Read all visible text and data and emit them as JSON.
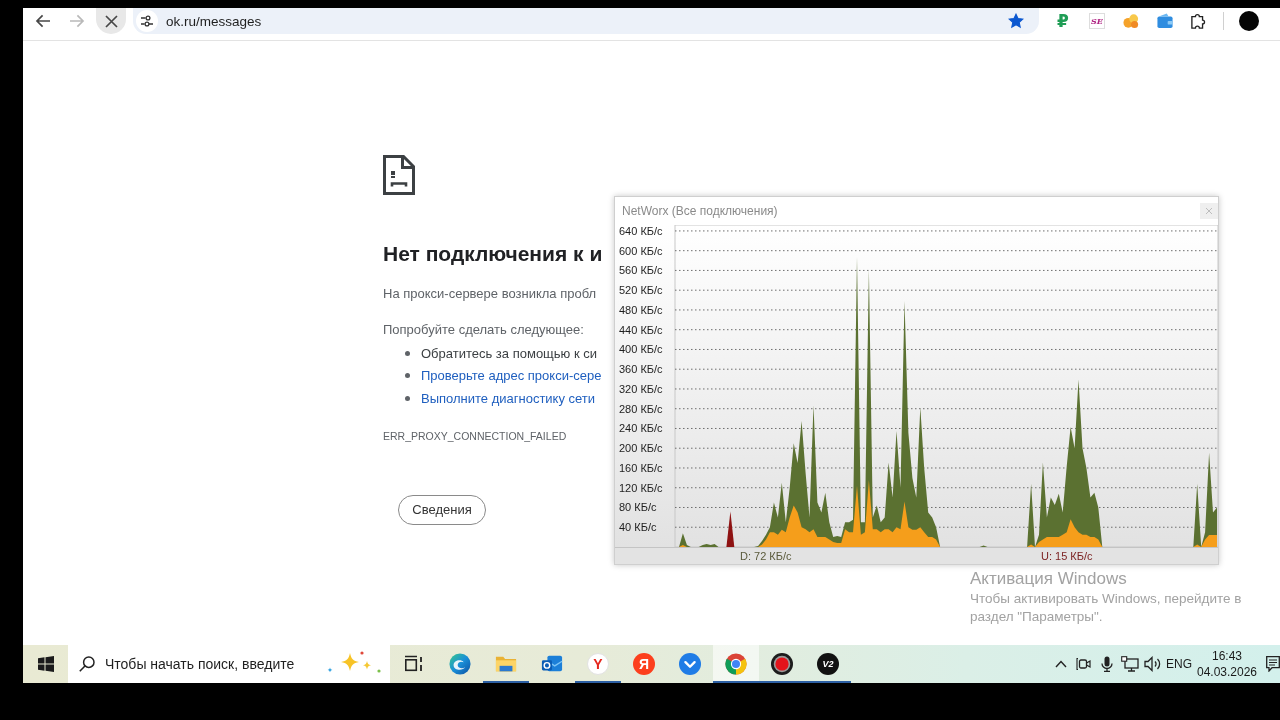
{
  "browser": {
    "back": {
      "disabled": false
    },
    "forward": {
      "disabled": true
    },
    "reload": {
      "loading": true,
      "hovered": true
    },
    "url": "ok.ru/messages",
    "bookmarked": true,
    "extensions": [
      {
        "kind": "ruble",
        "glyph": "₽"
      },
      {
        "kind": "letters",
        "glyph": "SE"
      },
      {
        "kind": "blobs"
      },
      {
        "kind": "wallet"
      },
      {
        "kind": "puzzle"
      }
    ]
  },
  "error_page": {
    "heading": "Нет подключения к и",
    "message": "На прокси-сервере возникла пробл",
    "suggestions_title": "Попробуйте сделать следующее:",
    "suggestions": [
      {
        "text": "Обратитесь за помощью к си",
        "link": false
      },
      {
        "text": "Проверьте адрес прокси-сере",
        "link": true
      },
      {
        "text": "Выполните диагностику сети",
        "link": true
      }
    ],
    "error_code": "ERR_PROXY_CONNECTION_FAILED",
    "details_button": "Сведения"
  },
  "networx": {
    "title": "NetWorx (Все подключения)",
    "chart_data": {
      "type": "area",
      "series": [
        {
          "color": "#5b7131",
          "values": [
            0,
            0,
            28,
            4,
            0,
            0,
            0,
            4,
            6,
            4,
            6,
            0,
            0,
            0,
            0,
            0,
            0,
            0,
            0,
            0,
            0,
            2,
            12,
            25,
            40,
            90,
            60,
            130,
            50,
            120,
            210,
            170,
            255,
            150,
            60,
            287,
            90,
            70,
            110,
            50,
            20,
            22,
            20,
            50,
            50,
            55,
            587,
            50,
            50,
            562,
            60,
            84,
            50,
            60,
            171,
            100,
            235,
            120,
            498,
            231,
            140,
            100,
            283,
            160,
            70,
            60,
            40,
            0,
            0,
            0,
            0,
            0,
            0,
            0,
            0,
            0,
            0,
            0,
            3,
            0,
            0,
            0,
            0,
            0,
            0,
            0,
            0,
            0,
            0,
            0,
            128,
            0,
            25,
            171,
            60,
            100,
            85,
            108,
            70,
            163,
            243,
            200,
            339,
            200,
            160,
            100,
            110,
            80,
            0,
            0,
            0,
            0,
            0,
            0,
            0,
            0,
            0,
            0,
            0,
            0,
            0,
            0,
            0,
            0,
            0,
            0,
            0,
            0,
            0,
            0,
            0,
            0,
            128,
            0,
            30,
            191,
            70,
            80
          ]
        },
        {
          "color": "#f59e1b",
          "values": [
            0,
            0,
            4,
            0,
            0,
            0,
            0,
            0,
            0,
            0,
            0,
            0,
            0,
            0,
            0,
            0,
            0,
            0,
            0,
            0,
            0,
            0,
            5,
            15,
            30,
            30,
            25,
            35,
            30,
            60,
            84,
            70,
            40,
            36,
            30,
            36,
            20,
            20,
            20,
            15,
            10,
            8,
            8,
            36,
            30,
            30,
            124,
            25,
            30,
            135,
            36,
            36,
            30,
            36,
            36,
            30,
            40,
            36,
            92,
            40,
            35,
            35,
            40,
            30,
            20,
            20,
            15,
            0,
            0,
            0,
            0,
            0,
            0,
            0,
            0,
            0,
            0,
            0,
            0,
            0,
            0,
            0,
            0,
            0,
            0,
            0,
            0,
            0,
            0,
            0,
            5,
            0,
            10,
            15,
            20,
            20,
            20,
            20,
            25,
            30,
            56,
            40,
            30,
            25,
            25,
            20,
            20,
            15,
            0,
            0,
            0,
            0,
            0,
            0,
            0,
            0,
            0,
            0,
            0,
            0,
            0,
            0,
            0,
            0,
            0,
            0,
            0,
            0,
            0,
            0,
            0,
            0,
            5,
            0,
            15,
            24,
            24,
            24
          ]
        },
        {
          "color": "#8e1212",
          "values": [
            null,
            null,
            null,
            null,
            null,
            null,
            null,
            null,
            null,
            null,
            null,
            null,
            null,
            0,
            72,
            0,
            null,
            null,
            null,
            null,
            null,
            null,
            null,
            null,
            null,
            null,
            null,
            null,
            null,
            null,
            null,
            null,
            null,
            null,
            null,
            null,
            null,
            null,
            null,
            null,
            null,
            null,
            null,
            null,
            null,
            null,
            null,
            null,
            null,
            null,
            null,
            null,
            null,
            null,
            null,
            null,
            null,
            null,
            null,
            null,
            null,
            null,
            null,
            null,
            null,
            null,
            null,
            null,
            null,
            null,
            null,
            null,
            null,
            null,
            null,
            null,
            null,
            null,
            null,
            null,
            null,
            null,
            null,
            null,
            null,
            null,
            null,
            null,
            null,
            null,
            null,
            null,
            null,
            null,
            null,
            null,
            null,
            null,
            null,
            null,
            null,
            null,
            null,
            null,
            null,
            null,
            null,
            null,
            null,
            null,
            null,
            null,
            null,
            null,
            null,
            null,
            null,
            null,
            null,
            null,
            null,
            null,
            null,
            null,
            null,
            null,
            null,
            null,
            null,
            null,
            null,
            null,
            null,
            null,
            null,
            null
          ]
        }
      ],
      "ylim": [
        0,
        652
      ],
      "yticks": [
        {
          "value": 40,
          "label": "40 КБ/с"
        },
        {
          "value": 80,
          "label": "80 КБ/с"
        },
        {
          "value": 120,
          "label": "120 КБ/с"
        },
        {
          "value": 160,
          "label": "160 КБ/с"
        },
        {
          "value": 200,
          "label": "200 КБ/с"
        },
        {
          "value": 240,
          "label": "240 КБ/с"
        },
        {
          "value": 280,
          "label": "280 КБ/с"
        },
        {
          "value": 320,
          "label": "320 КБ/с"
        },
        {
          "value": 360,
          "label": "360 КБ/с"
        },
        {
          "value": 400,
          "label": "400 КБ/с"
        },
        {
          "value": 440,
          "label": "440 КБ/с"
        },
        {
          "value": 480,
          "label": "480 КБ/с"
        },
        {
          "value": 520,
          "label": "520 КБ/с"
        },
        {
          "value": 560,
          "label": "560 КБ/с"
        },
        {
          "value": 600,
          "label": "600 КБ/с"
        },
        {
          "value": 640,
          "label": "640 КБ/с"
        }
      ],
      "tick_labels": "y",
      "grid": true
    },
    "status": {
      "download": "D: 72 КБ/с",
      "upload": "U: 15 КБ/с"
    }
  },
  "activation_notice": {
    "title": "Активация Windows",
    "text": "Чтобы активировать Windows, перейдите в\nраздел \"Параметры\"."
  },
  "taskbar": {
    "search": {
      "placeholder": "Чтобы начать поиск, введите"
    },
    "apps": [
      {
        "kind": "task-view",
        "running": false,
        "active": false
      },
      {
        "kind": "swirl",
        "running": false,
        "active": false
      },
      {
        "kind": "folder",
        "running": true,
        "active": false
      },
      {
        "kind": "mail",
        "running": false,
        "active": false
      },
      {
        "kind": "letter-circle",
        "glyph": "Y",
        "running": true,
        "active": false
      },
      {
        "kind": "letter-disc",
        "glyph": "Я",
        "running": false,
        "active": false
      },
      {
        "kind": "chevron",
        "running": false,
        "active": false
      },
      {
        "kind": "segmented",
        "running": true,
        "active": true
      },
      {
        "kind": "record",
        "running": true,
        "active": false
      },
      {
        "kind": "text-disc",
        "glyph": "V2",
        "running": true,
        "active": false
      }
    ],
    "tray": {
      "language": "ENG",
      "time": "16:43",
      "date": "04.03.2026"
    }
  }
}
